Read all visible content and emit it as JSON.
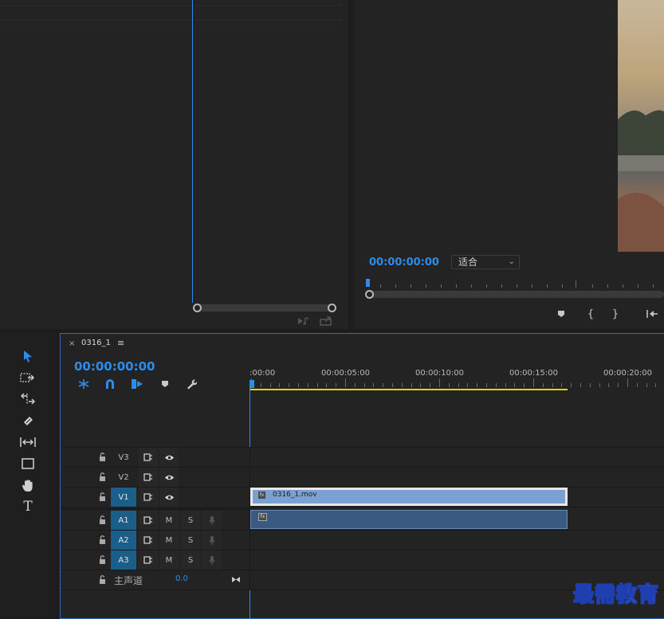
{
  "program": {
    "timecode": "00:00:00:00",
    "fit_label": "适合",
    "button_icons": [
      "marker-icon",
      "in-point-icon",
      "out-point-icon",
      "go-to-in-icon"
    ]
  },
  "tools": [
    "selection-tool-icon",
    "track-select-icon",
    "ripple-edit-icon",
    "razor-icon",
    "slip-icon",
    "rectangle-icon",
    "hand-icon",
    "type-icon"
  ],
  "timeline": {
    "tab_close": "×",
    "sequence_name": "0316_1",
    "tab_menu": "≡",
    "timecode": "00:00:00:00",
    "ruler_labels": [
      ":00:00",
      "00:00:05:00",
      "00:00:10:00",
      "00:00:15:00",
      "00:00:20:00"
    ],
    "video_tracks": [
      {
        "name": "V3"
      },
      {
        "name": "V2"
      },
      {
        "name": "V1"
      }
    ],
    "audio_tracks": [
      {
        "name": "A1",
        "m": "M",
        "s": "S"
      },
      {
        "name": "A2",
        "m": "M",
        "s": "S"
      },
      {
        "name": "A3",
        "m": "M",
        "s": "S"
      }
    ],
    "master": {
      "label": "主声道",
      "value": "0.0"
    },
    "clip_name": "0316_1.mov",
    "fx_label": "fx"
  },
  "watermark": "最需教育",
  "colors": {
    "accent": "#2d8ceb",
    "target_track": "#1b5e8a",
    "video_clip": "#7aa1d2",
    "audio_clip": "#3b5a80",
    "work_area": "#e6d400"
  }
}
